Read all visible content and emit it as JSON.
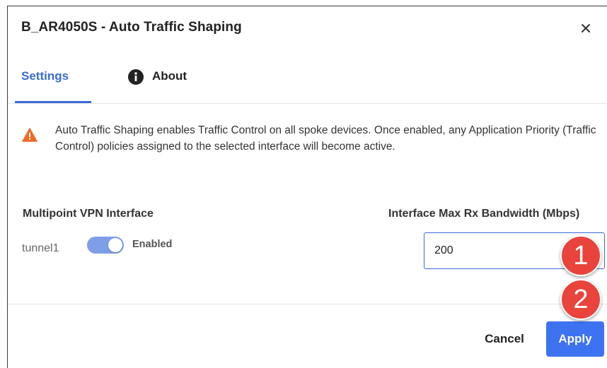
{
  "dialog": {
    "title": "B_AR4050S - Auto Traffic Shaping",
    "close_icon": "close-icon"
  },
  "tabs": [
    {
      "label": "Settings",
      "active": true
    },
    {
      "label": "About",
      "icon": "info-icon",
      "active": false
    }
  ],
  "warning": {
    "icon": "warning-triangle-icon",
    "color": "#ef6a2a",
    "text": "Auto Traffic Shaping enables Traffic Control on all spoke devices. Once enabled, any Application Priority (Traffic Control) policies assigned to the selected interface will become active."
  },
  "form": {
    "interface_header": "Multipoint VPN Interface",
    "bandwidth_header": "Interface Max Rx Bandwidth (Mbps)",
    "interface_name": "tunnel1",
    "toggle_state": "Enabled",
    "toggle_on": true,
    "bandwidth_value": "200"
  },
  "footer": {
    "cancel_label": "Cancel",
    "apply_label": "Apply"
  },
  "callouts": [
    "1",
    "2"
  ],
  "colors": {
    "accent": "#3a6bd8",
    "apply_button": "#3d73f0",
    "callout": "#e8443c",
    "toggle_track": "#7e9ee8"
  }
}
